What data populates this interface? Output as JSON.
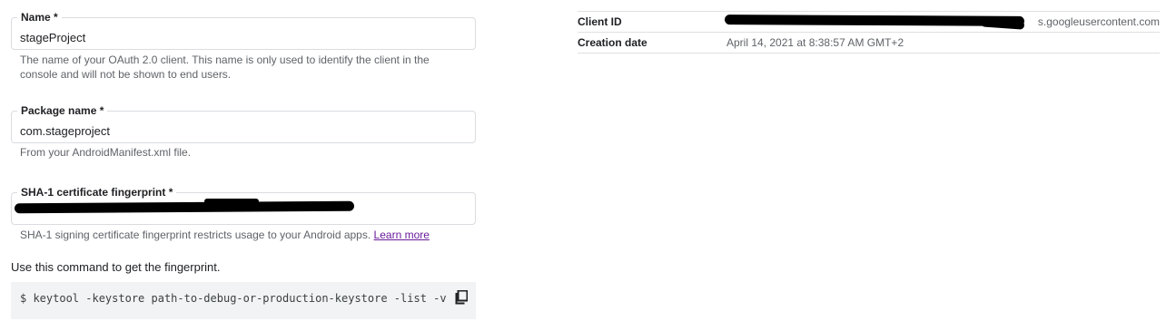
{
  "form": {
    "name": {
      "label": "Name *",
      "value": "stageProject",
      "hint": "The name of your OAuth 2.0 client. This name is only used to identify the client in the console and will not be shown to end users."
    },
    "package": {
      "label": "Package name *",
      "value": "com.stageproject",
      "hint": "From your AndroidManifest.xml file."
    },
    "sha1": {
      "label": "SHA-1 certificate fingerprint *",
      "value": "",
      "hint": "SHA-1 signing certificate fingerprint restricts usage to your Android apps.",
      "learn_more": "Learn more"
    },
    "instruction": "Use this command to get the fingerprint.",
    "command": "$ keytool -keystore path-to-debug-or-production-keystore -list -v",
    "copy_icon": "copy-icon"
  },
  "details": {
    "client_id": {
      "key": "Client ID",
      "value_suffix": "s.googleusercontent.com"
    },
    "creation_date": {
      "key": "Creation date",
      "value": "April 14, 2021 at 8:38:57 AM GMT+2"
    }
  }
}
